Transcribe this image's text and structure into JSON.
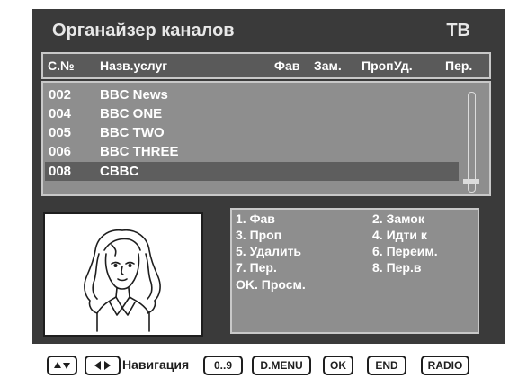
{
  "window": {
    "title": "Органайзер каналов",
    "mode": "ТВ"
  },
  "columns": {
    "number": "С.№",
    "name": "Назв.услуг",
    "fav": "Фав",
    "lock": "Зам.",
    "skip": "Проп",
    "delete": "Уд.",
    "rename": "Пер."
  },
  "channels": [
    {
      "number": "002",
      "name": "BBC News",
      "selected": false
    },
    {
      "number": "004",
      "name": "BBC ONE",
      "selected": false
    },
    {
      "number": "005",
      "name": "BBC TWO",
      "selected": false
    },
    {
      "number": "006",
      "name": "BBC THREE",
      "selected": false
    },
    {
      "number": "008",
      "name": "CBBC",
      "selected": true
    }
  ],
  "menu": {
    "left": [
      "1. Фав",
      "3. Проп",
      "5. Удалить",
      "7. Пер.",
      "OK. Просм."
    ],
    "right": [
      "2. Замок",
      "4. Идти к",
      "6. Переим.",
      "8. Пер.в"
    ]
  },
  "footer": {
    "nav_label": "Навигация",
    "keys": [
      "0..9",
      "D.MENU",
      "OK",
      "END",
      "RADIO"
    ]
  },
  "colors": {
    "screen_bg": "#3a3a3a",
    "list_bg": "#8e8e8e",
    "selected_row": "#5e5e5e",
    "text": "#ffffff"
  }
}
